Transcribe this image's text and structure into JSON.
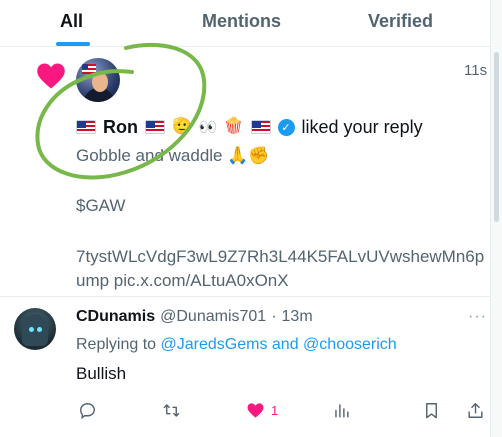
{
  "tabs": [
    {
      "label": "All",
      "active": true
    },
    {
      "label": "Mentions",
      "active": false
    },
    {
      "label": "Verified",
      "active": false
    }
  ],
  "notification": {
    "type_icon": "heart-icon",
    "time": "11s",
    "user_name": "Ron",
    "liked_text": "liked your reply",
    "reply_text": "Gobble and waddle",
    "reply_emoji": "🙏✊",
    "ticker": "$GAW",
    "contract_text": "7tystWLcVdgF3wL9Z7Rh3L44K5FALvUVwshewMn6pump pic.x.com/ALtuA0xOnX"
  },
  "reply_tweet": {
    "name": "CDunamis",
    "handle": "@Dunamis701",
    "dot": "·",
    "time": "13m",
    "replying_prefix": "Replying to",
    "mention1": "@JaredsGems",
    "and": "and",
    "mention2": "@chooserich",
    "body": "Bullish",
    "more": "···",
    "like_count": "1"
  },
  "colors": {
    "accent": "#1d9bf0",
    "like": "#f91880",
    "muted": "#536471",
    "annotation": "#78b84a"
  }
}
